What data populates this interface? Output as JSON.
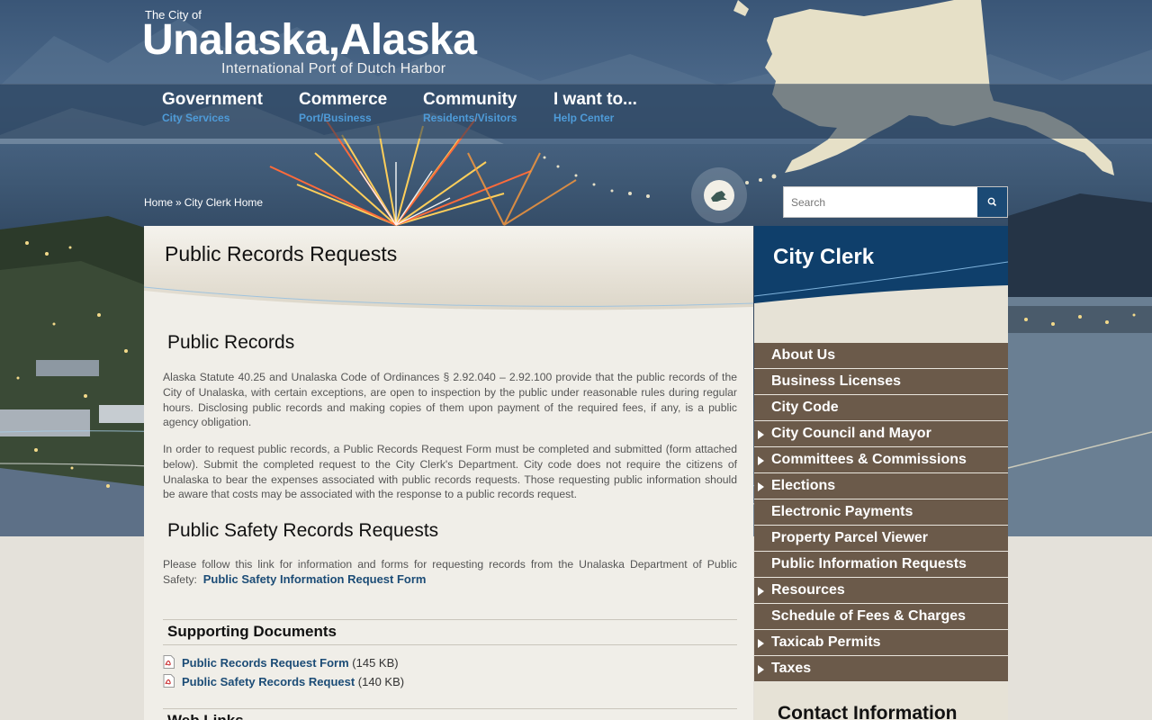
{
  "header": {
    "prefix": "The City of",
    "city_name": "Unalaska,Alaska",
    "tagline": "International Port of Dutch Harbor"
  },
  "nav": [
    {
      "label": "Government",
      "sub": "City Services"
    },
    {
      "label": "Commerce",
      "sub": "Port/Business"
    },
    {
      "label": "Community",
      "sub": "Residents/Visitors"
    },
    {
      "label": "I want to...",
      "sub": "Help Center"
    }
  ],
  "breadcrumb": {
    "home": "Home",
    "separator": "»",
    "current": "City Clerk Home"
  },
  "search": {
    "placeholder": "Search",
    "icon": "search-icon"
  },
  "main": {
    "page_title": "Public Records Requests",
    "section1_title": "Public Records",
    "section1_p1": "Alaska Statute 40.25 and Unalaska Code of Ordinances § 2.92.040 – 2.92.100 provide that the public records of the City of Unalaska, with certain exceptions, are open to inspection by the public under reasonable rules during regular hours. Disclosing public records and making copies of them upon payment of the required fees, if any, is a public agency obligation.",
    "section1_p2": "In order to request public records, a Public Records Request Form must be completed and submitted (form attached below). Submit the completed request to the City Clerk's Department. City code does not require the citizens of Unalaska to bear the expenses associated with public records requests. Those requesting public information should be aware that costs may be associated with the response to a public records request.",
    "section2_title": "Public Safety Records Requests",
    "section2_text": "Please follow this link for information and forms for requesting records from the Unalaska Department of Public Safety:",
    "section2_link": "Public Safety Information Request Form",
    "docs_title": "Supporting Documents",
    "documents": [
      {
        "name": "Public Records Request Form",
        "size": "(145 KB)",
        "icon": "pdf-icon"
      },
      {
        "name": "Public Safety Records Request",
        "size": "(140 KB)",
        "icon": "pdf-icon"
      }
    ],
    "weblinks_title": "Web Links"
  },
  "sidebar": {
    "title": "City Clerk",
    "menu": [
      {
        "label": "About Us",
        "expandable": false
      },
      {
        "label": "Business Licenses",
        "expandable": false
      },
      {
        "label": "City Code",
        "expandable": false
      },
      {
        "label": "City Council and Mayor",
        "expandable": true
      },
      {
        "label": "Committees & Commissions",
        "expandable": true
      },
      {
        "label": "Elections",
        "expandable": true
      },
      {
        "label": "Electronic Payments",
        "expandable": false
      },
      {
        "label": "Property Parcel Viewer",
        "expandable": false
      },
      {
        "label": "Public Information Requests",
        "expandable": false
      },
      {
        "label": "Resources",
        "expandable": true
      },
      {
        "label": "Schedule of Fees & Charges",
        "expandable": false
      },
      {
        "label": "Taxicab Permits",
        "expandable": true
      },
      {
        "label": "Taxes",
        "expandable": true
      }
    ],
    "contact_title": "Contact Information"
  },
  "colors": {
    "nav_sub": "#4e9bd8",
    "link": "#1c4c76",
    "sidebar_menu_bg": "#6b5a4a",
    "sidebar_header_bg": "#0f3f6b",
    "search_button_bg": "#1b4a75"
  }
}
